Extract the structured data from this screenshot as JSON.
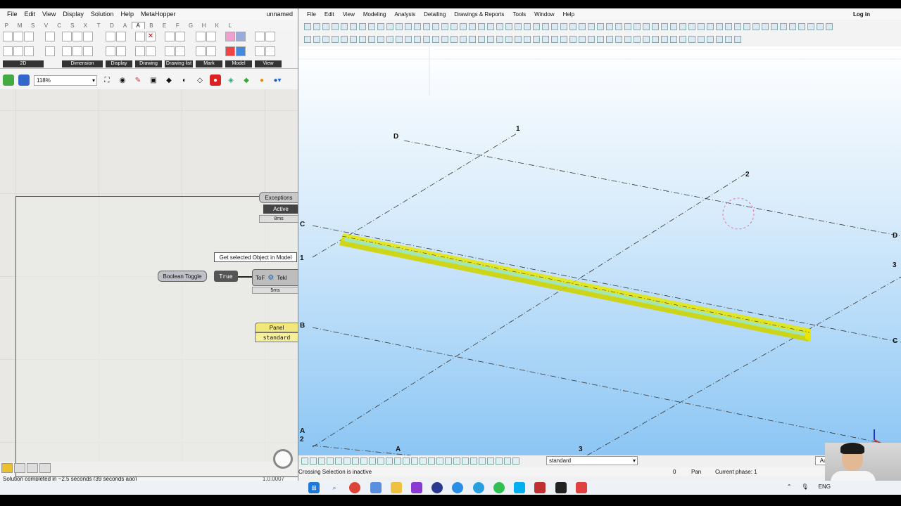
{
  "grasshopper": {
    "menu": [
      "File",
      "Edit",
      "View",
      "Display",
      "Solution",
      "Help",
      "MetaHopper"
    ],
    "doc_name": "unnamed",
    "tabs": [
      "P",
      "M",
      "S",
      "V",
      "C",
      "S",
      "X",
      "T",
      "D",
      "A",
      "A",
      "B",
      "E",
      "F",
      "G",
      "H",
      "K",
      "L"
    ],
    "ribbon_groups": [
      "2D",
      "Dimension",
      "Display",
      "Drawing",
      "Drawing list",
      "Mark",
      "Model",
      "View"
    ],
    "zoom": "118%",
    "nodes": {
      "exceptions": "Exceptions",
      "active": "Active",
      "time_8ms": "8ms",
      "tooltip": "Get selected Object in Model",
      "boolean_toggle": "Boolean Toggle",
      "toggle_value": "True",
      "tekla_component": "Tekl",
      "tof": "ToF",
      "time_5ms": "5ms",
      "panel_title": "Panel",
      "panel_value": "standard"
    },
    "status": "Solution completed in ~2.5 seconds (39 seconds ago)",
    "version": "1.0.0007"
  },
  "tekla": {
    "menu": [
      "File",
      "Edit",
      "View",
      "Modeling",
      "Analysis",
      "Detailing",
      "Drawings & Reports",
      "Tools",
      "Window",
      "Help"
    ],
    "login": "Log in",
    "grid_labels": {
      "d_left": "D",
      "one_top": "1",
      "two_top": "2",
      "c_left": "C",
      "one_left": "1",
      "b_left": "B",
      "a_left": "A",
      "two_left": "2",
      "a_bottom": "A",
      "three_bottom": "3",
      "d_right": "D",
      "three_right": "3",
      "c_right": "C"
    },
    "view_name": "standard",
    "auto_label": "Auto",
    "status_left": "Crossing Selection is inactive",
    "status_zero": "0",
    "status_mode": "Pan",
    "status_phase": "Current phase: 1",
    "colors": {
      "beam": "#e6e600",
      "beam_core": "#9fe6b8",
      "sky": "#8cc6f4"
    }
  },
  "taskbar": {
    "lang": "ENG"
  }
}
